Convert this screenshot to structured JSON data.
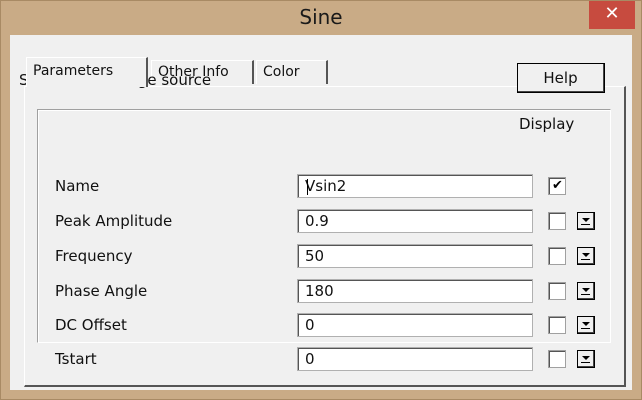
{
  "window": {
    "title": "Sine",
    "close_glyph": "✕"
  },
  "tabs": [
    {
      "label": "Parameters",
      "active": true
    },
    {
      "label": "Other Info",
      "active": false
    },
    {
      "label": "Color",
      "active": false
    }
  ],
  "parameters": {
    "description": "Sinusoidal voltage source",
    "help_label": "Help",
    "display_header": "Display",
    "rows": [
      {
        "label": "Name",
        "value": "Vsin2",
        "display_checked": true,
        "has_dropdown": false
      },
      {
        "label": "Peak Amplitude",
        "value": "0.9",
        "display_checked": false,
        "has_dropdown": true
      },
      {
        "label": "Frequency",
        "value": "50",
        "display_checked": false,
        "has_dropdown": true
      },
      {
        "label": "Phase Angle",
        "value": "180",
        "display_checked": false,
        "has_dropdown": true
      },
      {
        "label": "DC Offset",
        "value": "0",
        "display_checked": false,
        "has_dropdown": true
      },
      {
        "label": "Tstart",
        "value": "0",
        "display_checked": false,
        "has_dropdown": true
      }
    ]
  },
  "colors": {
    "frame": "#c9ab86",
    "close_button": "#c74b3f",
    "client": "#f0f0f0"
  },
  "icons": {
    "close": "close-icon",
    "check": "check-icon",
    "dropdown": "dropdown-arrow-icon"
  },
  "check_glyph": "✔"
}
